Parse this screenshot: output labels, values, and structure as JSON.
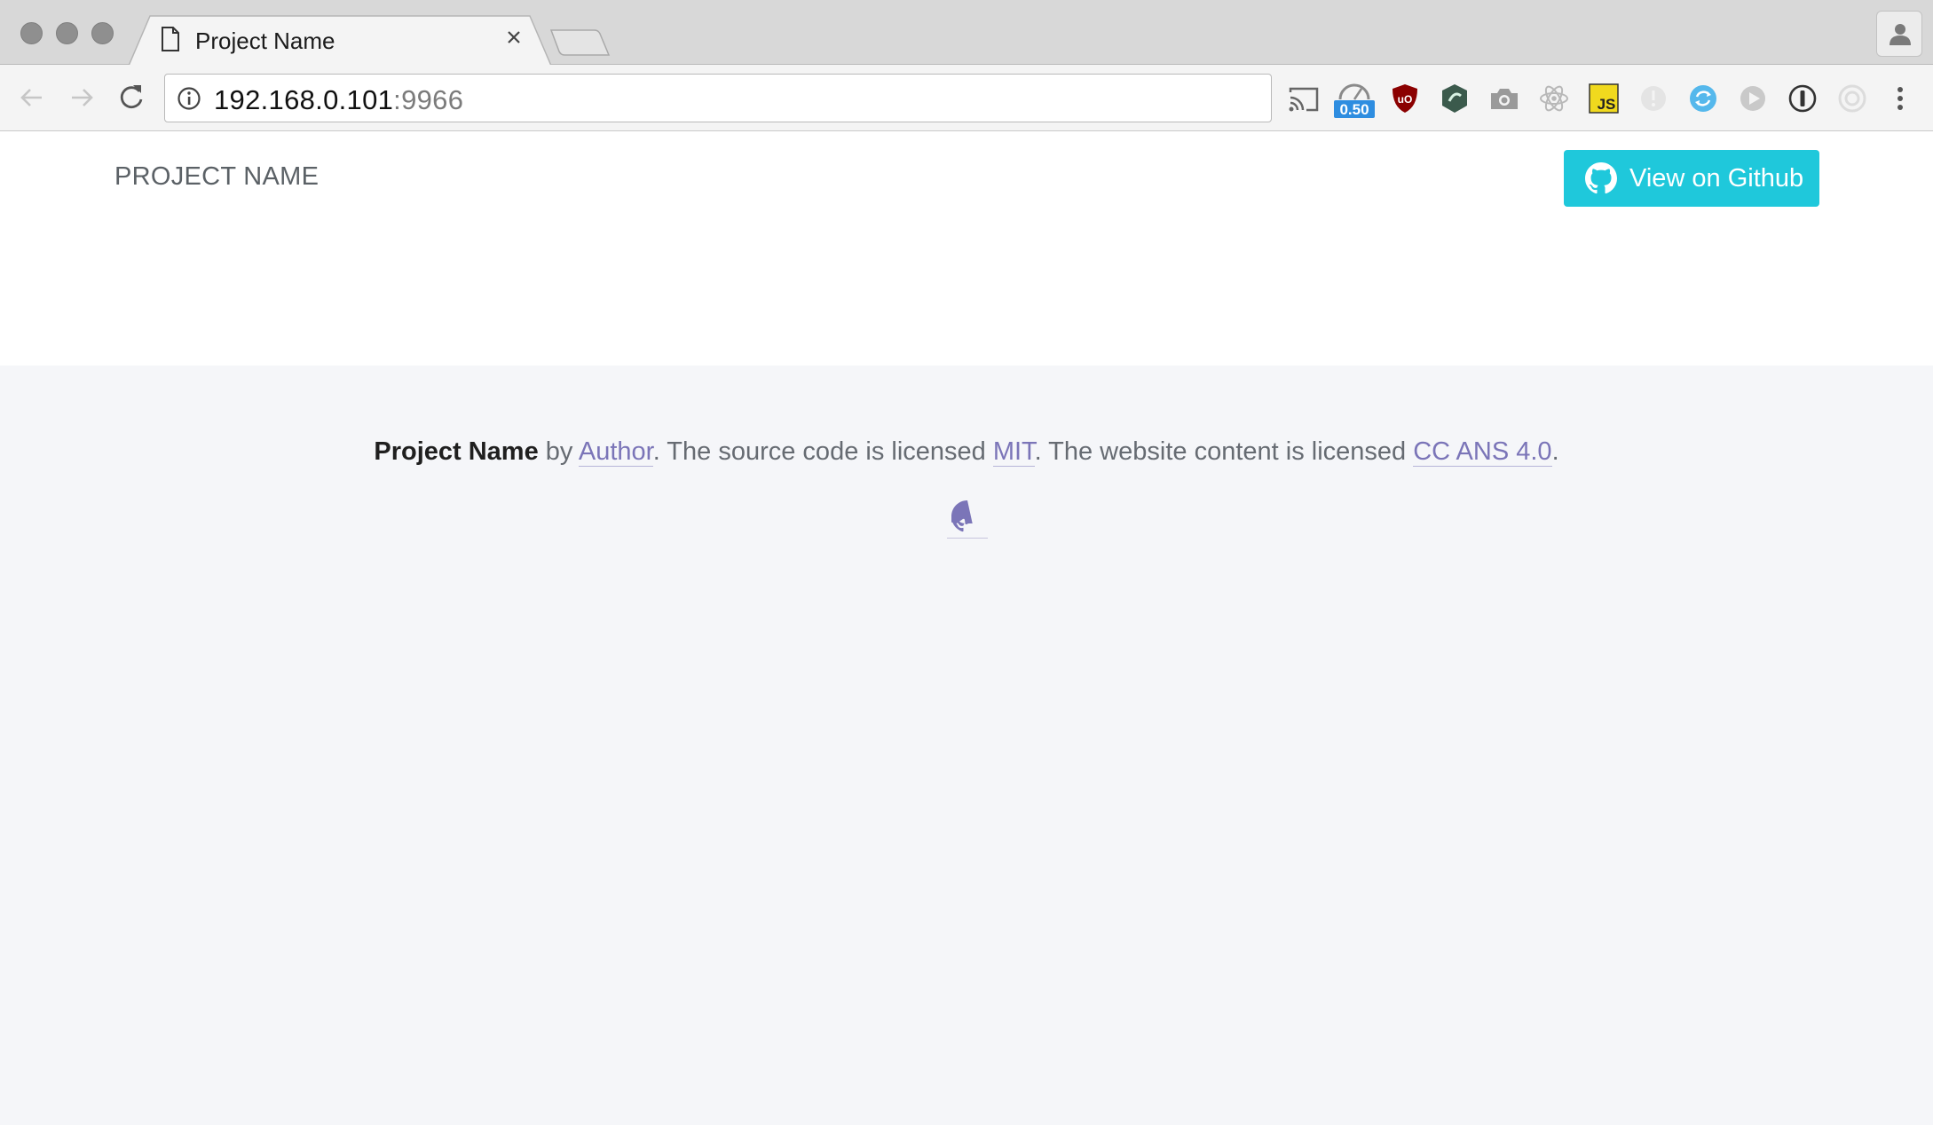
{
  "browser": {
    "tab": {
      "title": "Project Name",
      "icon": "document-icon",
      "close_icon": "close-icon"
    },
    "url": {
      "host": "192.168.0.101",
      "port": ":9966"
    },
    "extensions": [
      {
        "name": "cast-icon"
      },
      {
        "name": "speed-gauge-icon",
        "badge": "0.50"
      },
      {
        "name": "ublock-icon"
      },
      {
        "name": "green-shield-icon"
      },
      {
        "name": "camera-icon"
      },
      {
        "name": "react-devtools-icon"
      },
      {
        "name": "js-icon",
        "label": "JS"
      },
      {
        "name": "disabled-alert-icon"
      },
      {
        "name": "sync-icon"
      },
      {
        "name": "play-icon"
      },
      {
        "name": "onepassword-icon"
      },
      {
        "name": "target-icon"
      }
    ],
    "colors": {
      "tabstrip": "#d8d8d8",
      "toolbar": "#f4f4f4"
    }
  },
  "page": {
    "nav": {
      "brand": "PROJECT NAME",
      "github_button_label": "View on Github"
    },
    "footer": {
      "project": "Project Name",
      "by": " by ",
      "author": "Author",
      "text1": ". The source code is licensed ",
      "mit": "MIT",
      "text2": ". The website content is licensed ",
      "cc": "CC ANS 4.0",
      "end": "."
    },
    "colors": {
      "accent": "#1fc8db",
      "link": "#7b75b8",
      "footer_bg": "#f5f6f9"
    }
  }
}
